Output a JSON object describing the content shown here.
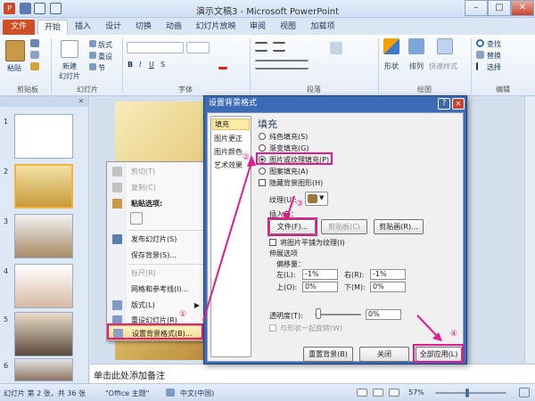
{
  "window": {
    "title": "演示文稿3 - Microsoft PowerPoint",
    "app_icon": "powerpoint-icon",
    "min": "–",
    "max": "□",
    "close": "✕"
  },
  "tabs": [
    "文件",
    "开始",
    "插入",
    "设计",
    "切换",
    "动画",
    "幻灯片放映",
    "审阅",
    "视图",
    "加载项"
  ],
  "ribbon": {
    "groups": [
      "剪贴板",
      "幻灯片",
      "字体",
      "段落",
      "绘图",
      "编辑"
    ],
    "paste": "粘贴",
    "new_slide": "新建\n幻灯片",
    "layout": "版式",
    "reset": "重设",
    "section": "节",
    "shape": "形状",
    "arrange": "排列",
    "quick_styles": "快速样式",
    "find": "查找",
    "replace": "替换",
    "select": "选择"
  },
  "slides": [
    "1",
    "2",
    "3",
    "4",
    "5",
    "6",
    "7"
  ],
  "notes_placeholder": "单击此处添加备注",
  "status": {
    "slide_info": "幻灯片 第 2 张，共 36 张",
    "theme": "\"Office 主题\"",
    "lang": "中文(中国)",
    "zoom": "57%"
  },
  "context_menu": {
    "items": [
      "剪切(T)",
      "复制(C)",
      "粘贴选项:",
      "发布幻灯片(S)",
      "保存背景(S)...",
      "标尺(R)",
      "网格和参考线(I)...",
      "版式(L)",
      "重设幻灯片(R)",
      "设置背景格式(B)..."
    ],
    "marker": "①"
  },
  "dialog": {
    "title": "设置背景格式",
    "nav": [
      "填充",
      "图片更正",
      "图片颜色",
      "艺术效果"
    ],
    "heading": "填充",
    "fill_options": [
      "纯色填充(S)",
      "渐变填充(G)",
      "图片或纹理填充(P)",
      "图案填充(A)"
    ],
    "hide_bg": "隐藏背景图形(H)",
    "texture_label": "纹理(U):",
    "insert_from": "插入自：",
    "btn_file": "文件(F)...",
    "btn_clipboard": "剪贴板(C)",
    "btn_clipart": "剪贴画(R)...",
    "tile": "将图片平铺为纹理(I)",
    "stretch": "伸展选项",
    "offsets": "偏移量：",
    "left": "左(L):",
    "left_val": "-1%",
    "right": "右(R):",
    "right_val": "-1%",
    "top": "上(O):",
    "top_val": "0%",
    "bottom": "下(M):",
    "bottom_val": "0%",
    "transparency": "透明度(T):",
    "trans_val": "0%",
    "rotate": "与形状一起旋转(W)",
    "btn_reset": "重置背景(B)",
    "btn_close": "关闭",
    "btn_apply_all": "全部应用(L)",
    "markers": [
      "②",
      "③",
      "④"
    ],
    "help": "?",
    "x": "✕"
  }
}
